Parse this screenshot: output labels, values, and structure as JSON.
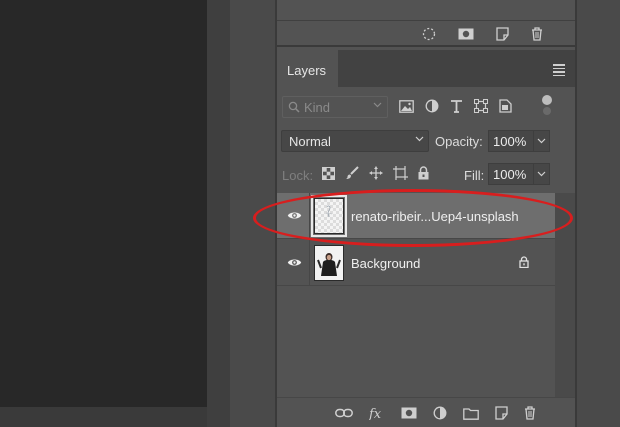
{
  "layers_panel": {
    "tab_label": "Layers",
    "filter": {
      "placeholder": "Kind"
    },
    "blend_mode": "Normal",
    "opacity_label": "Opacity:",
    "opacity_value": "100%",
    "lock_label": "Lock:",
    "fill_label": "Fill:",
    "fill_value": "100%",
    "layers": [
      {
        "name": "renato-ribeir...Uep4-unsplash",
        "selected": true,
        "visible": true
      },
      {
        "name": "Background",
        "selected": false,
        "visible": true,
        "locked": true
      }
    ]
  },
  "colors": {
    "annotation": "#d81e1e",
    "selected_row": "#6e6e6e",
    "panel_bg": "#535353"
  },
  "icons": {
    "top_panel": [
      "dashed-circle-icon",
      "mask-icon",
      "page-curl-icon",
      "trash-icon"
    ],
    "filter": [
      "image-filter-icon",
      "adjustment-filter-icon",
      "type-filter-icon",
      "shape-filter-icon",
      "smart-object-filter-icon"
    ],
    "lock": [
      "lock-transparent-icon",
      "lock-brush-icon",
      "lock-position-icon",
      "lock-artboard-icon",
      "lock-all-icon"
    ],
    "bottom": [
      "link-icon",
      "fx-icon",
      "layer-mask-icon",
      "adjustment-layer-icon",
      "group-folder-icon",
      "new-layer-icon",
      "delete-icon"
    ]
  }
}
